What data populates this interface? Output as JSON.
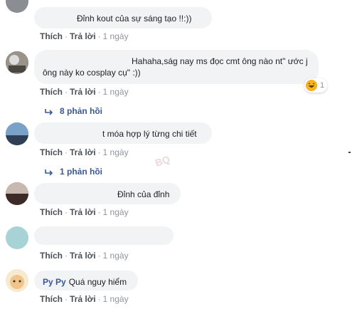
{
  "actions": {
    "like": "Thích",
    "reply": "Trả lời",
    "time": "1 ngày"
  },
  "comments": [
    {
      "text": "Đỉnh kout của sự sáng tạo !!:))"
    },
    {
      "line1": "Hahaha,ság nay ms đọc cmt ông nào nt\" ước j",
      "line2": "ông này ko cosplay cụ\" :))",
      "reaction_count": "1",
      "reaction_icon": "haha-reaction-icon",
      "replies": "8 phản hồi"
    },
    {
      "text": "t móa hợp lý từng chi tiết",
      "replies": "1 phản hồi"
    },
    {
      "text": "Đỉnh của đỉnh"
    },
    {
      "text": ""
    },
    {
      "name": "Py Py",
      "text": "Quá nguy hiểm"
    }
  ],
  "watermark": "BQ"
}
